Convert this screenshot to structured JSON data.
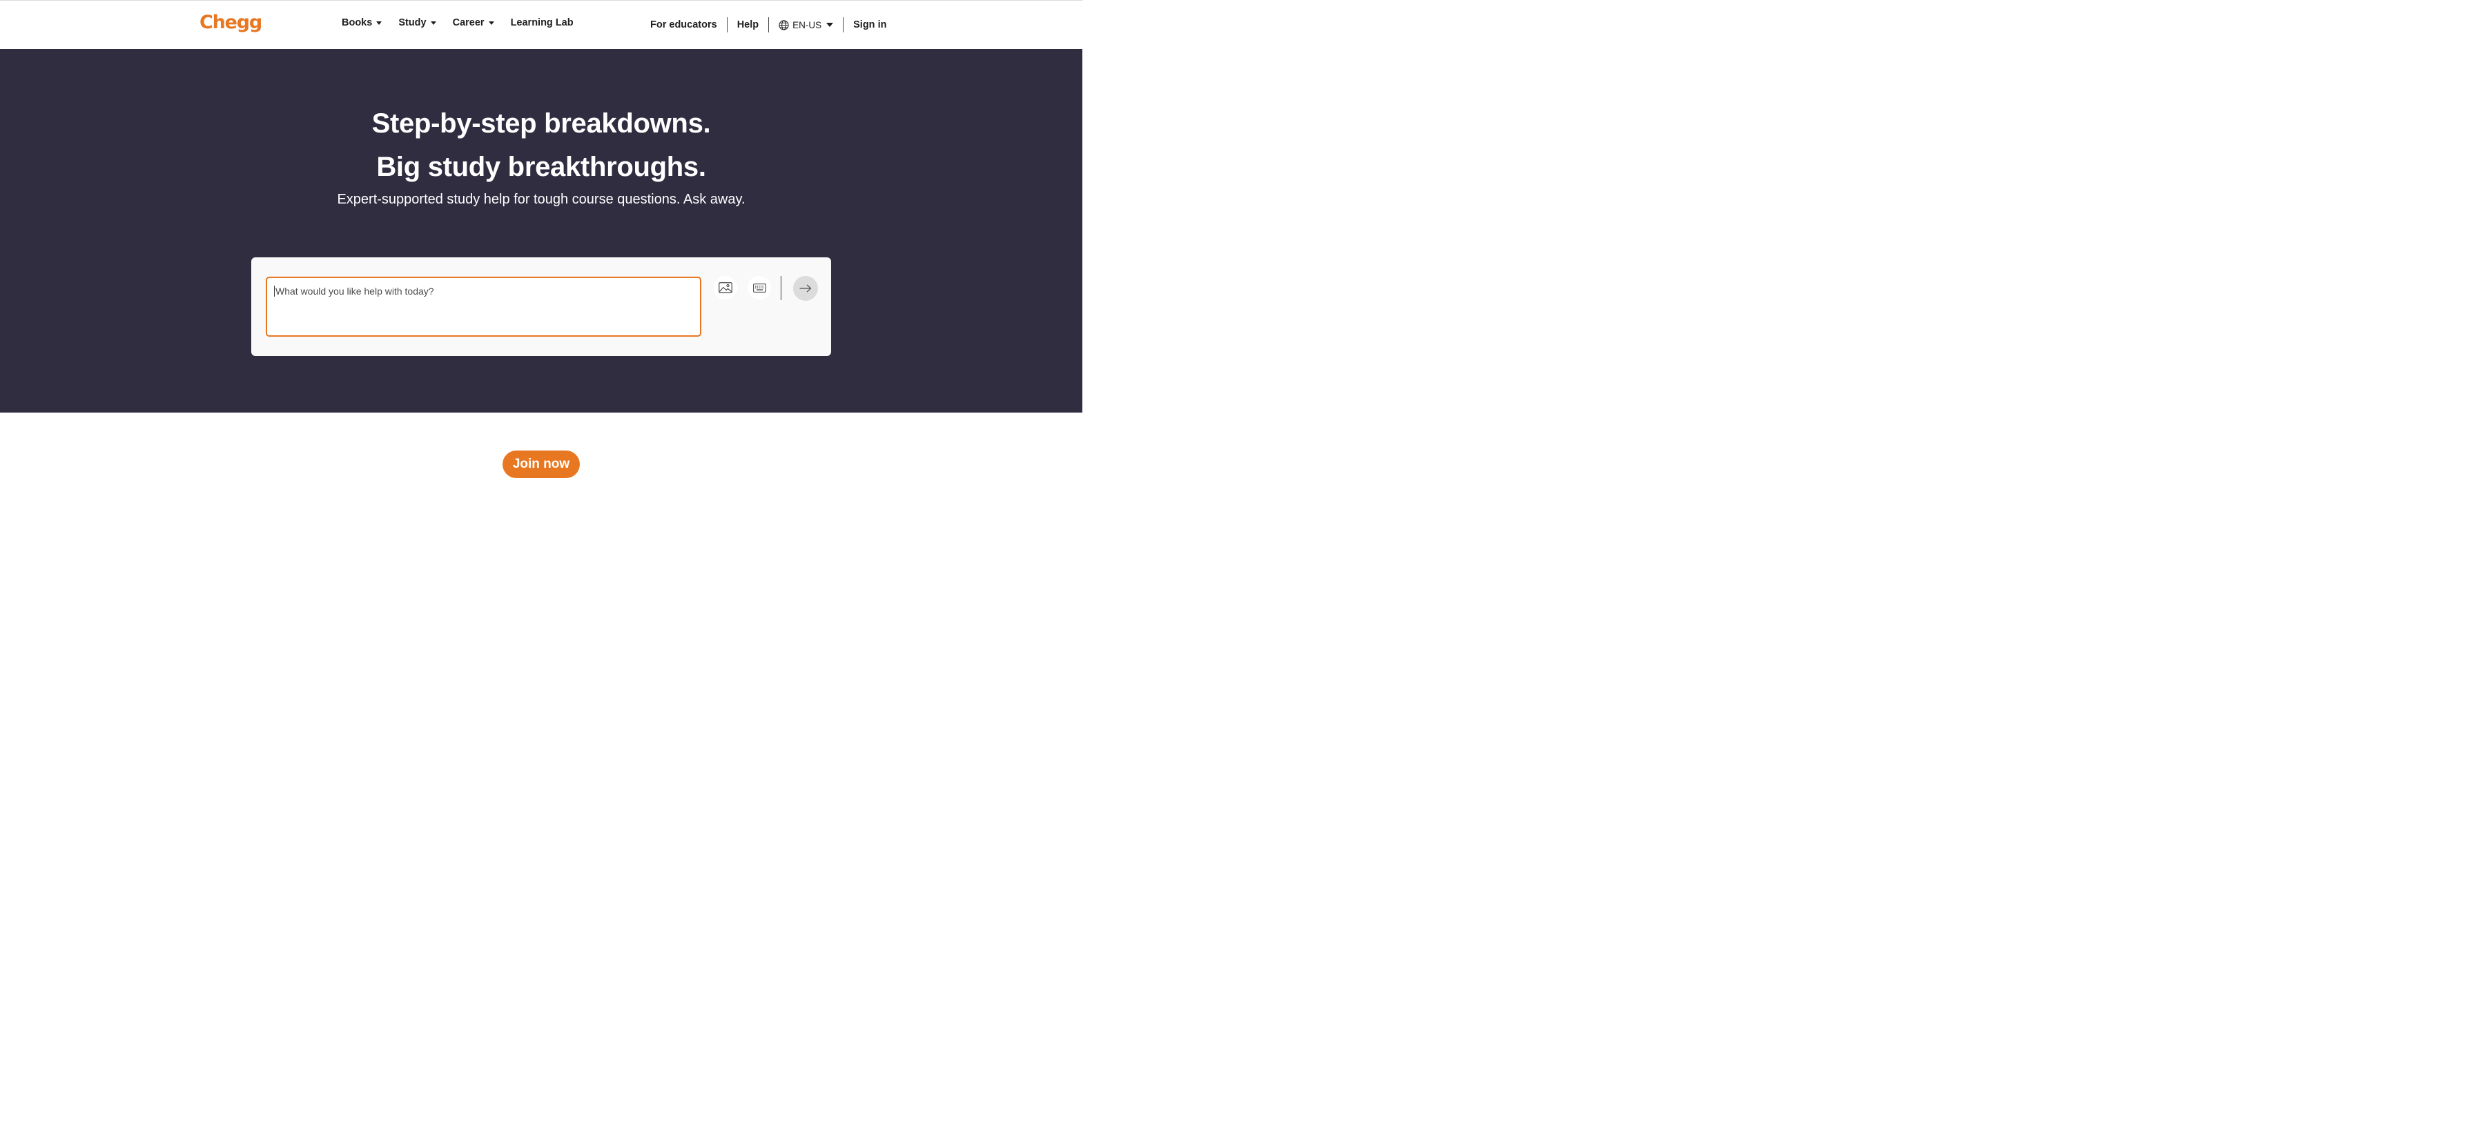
{
  "colors": {
    "brand_orange": "#e87722",
    "hero_background": "#302d41",
    "card_background": "#f9f9f9"
  },
  "header": {
    "logo": "Chegg",
    "nav": [
      {
        "label": "Books",
        "has_dropdown": true
      },
      {
        "label": "Study",
        "has_dropdown": true
      },
      {
        "label": "Career",
        "has_dropdown": true
      },
      {
        "label": "Learning Lab",
        "has_dropdown": false
      }
    ],
    "for_educators": "For educators",
    "help": "Help",
    "language": {
      "icon": "globe-icon",
      "value": "EN-US"
    },
    "sign_in": "Sign in"
  },
  "hero": {
    "headline_line1": "Step-by-step breakdowns.",
    "headline_line2": "Big study breakthroughs.",
    "subtitle": "Expert-supported study help for tough course questions. Ask away."
  },
  "search": {
    "placeholder": "What would you like help with today?",
    "value": "",
    "icons": [
      "image-upload-icon",
      "keyboard-icon",
      "arrow-right-icon"
    ]
  },
  "cta": {
    "join_label": "Join now"
  }
}
